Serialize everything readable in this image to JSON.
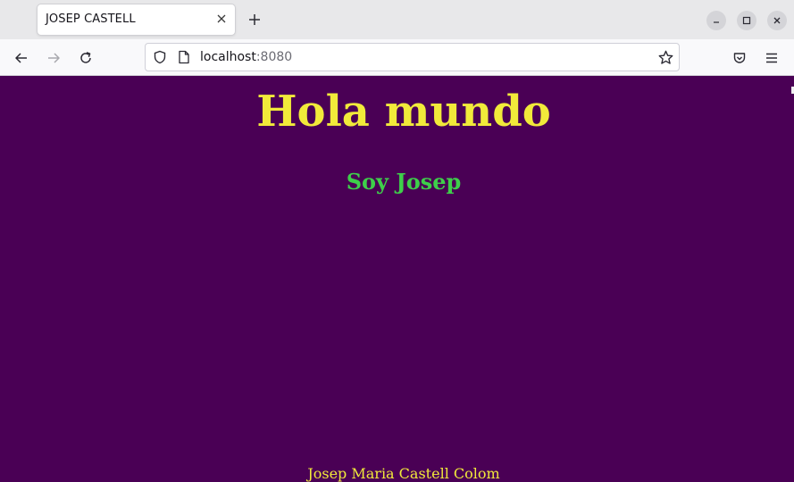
{
  "browser": {
    "tab": {
      "title": "JOSEP CASTELL",
      "close_icon": "close-icon"
    },
    "new_tab_icon": "plus-icon",
    "window_controls": [
      "minimize-icon",
      "maximize-icon",
      "close-icon"
    ],
    "nav": {
      "back_icon": "arrow-left-icon",
      "forward_icon": "arrow-right-icon",
      "reload_icon": "reload-icon",
      "pocket_icon": "pocket-icon",
      "menu_icon": "hamburger-menu-icon"
    },
    "url": {
      "host": "localhost",
      "port": ":8080",
      "shield_icon": "shield-icon",
      "page_icon": "page-icon",
      "bookmark_icon": "star-icon"
    }
  },
  "page": {
    "heading": "Hola mundo",
    "subheading": "Soy Josep",
    "footer": "Josep Maria Castell Colom",
    "colors": {
      "background": "#4a0055",
      "heading": "#f1ea3a",
      "subheading": "#3ecf4a",
      "footer": "#f1ea3a"
    }
  }
}
